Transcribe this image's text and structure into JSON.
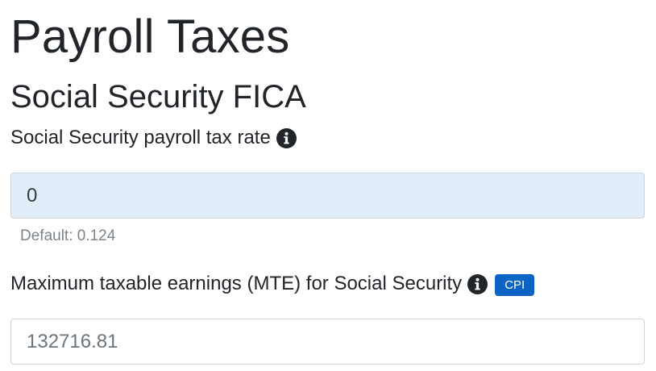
{
  "page": {
    "title": "Payroll Taxes",
    "section_title": "Social Security FICA"
  },
  "fields": [
    {
      "label": "Social Security payroll tax rate",
      "info_icon": "info-circle-icon",
      "value": "0",
      "help": "Default: 0.124"
    },
    {
      "label": "Maximum taxable earnings (MTE) for Social Security",
      "info_icon": "info-circle-icon",
      "badge": "CPI",
      "value": "",
      "placeholder": "132716.81"
    }
  ],
  "colors": {
    "badge_bg": "#0b63c6",
    "modified_input_bg": "#e1edf9",
    "help_text": "#7d848b"
  }
}
